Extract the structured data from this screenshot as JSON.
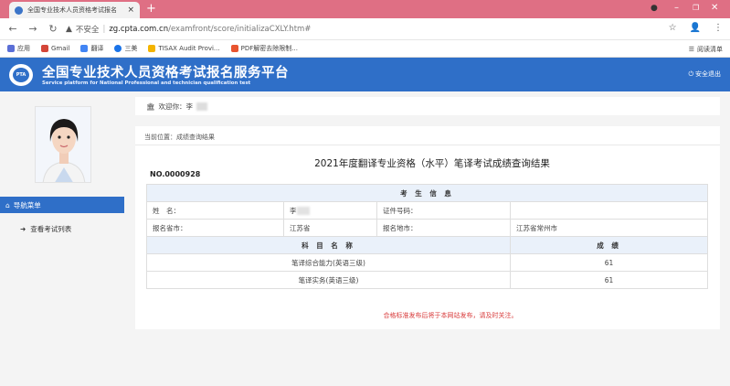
{
  "browser": {
    "tab_title": "全国专业技术人员资格考试报名",
    "new_tab": "+",
    "tab_close": "×",
    "address": {
      "insecure_label": "不安全",
      "separator": "|",
      "host": "zg.cpta.com.cn",
      "path": "/examfront/score/initializaCXLY.htm#"
    },
    "bookmarks": [
      {
        "label": "应用",
        "color": "#5b6fd6"
      },
      {
        "label": "Gmail",
        "color": "#d44638"
      },
      {
        "label": "翻译",
        "color": "#4285f4"
      },
      {
        "label": "三美",
        "color": "#1a73e8"
      },
      {
        "label": "TISAX Audit Provi...",
        "color": "#f4b400"
      },
      {
        "label": "PDF解密去除限制...",
        "color": "#e8542f"
      }
    ],
    "reading_list": "阅读清单"
  },
  "header": {
    "title": "全国专业技术人员资格考试报名服务平台",
    "subtitle": "Service platform for National Professional and technician qualification test",
    "logo_text": "PTA",
    "logout": "安全退出"
  },
  "sidebar": {
    "menu_heading": "导航菜单",
    "menu_toggle": "‹",
    "items": [
      {
        "label": "查看考试列表"
      }
    ]
  },
  "welcome": {
    "prefix": "欢迎你：李"
  },
  "breadcrumb": "当前位置：成绩查询结果",
  "result": {
    "title": "2021年度翻译专业资格（水平）笔译考试成绩查询结果",
    "cert_no": "NO.0000928",
    "info_header": "考 生 信 息",
    "name_label": "姓　名：",
    "name_value": "李",
    "id_label": "证件号码：",
    "id_value": "",
    "province_label": "报名省市：",
    "province_value": "江苏省",
    "city_label": "报名地市：",
    "city_value": "江苏省常州市",
    "subject_header": "科 目 名 称",
    "score_header": "成 绩",
    "subjects": [
      {
        "name": "笔译综合能力(英语三级)",
        "score": "61"
      },
      {
        "name": "笔译实务(英语三级)",
        "score": "61"
      }
    ]
  },
  "notice": "合格标准发布后将于本网站发布，请及时关注。",
  "colors": {
    "brand_blue": "#2f6fc8",
    "tab_bar": "#df6f84",
    "notice_red": "#d83a3a",
    "table_header_bg": "#eaf1fa"
  }
}
